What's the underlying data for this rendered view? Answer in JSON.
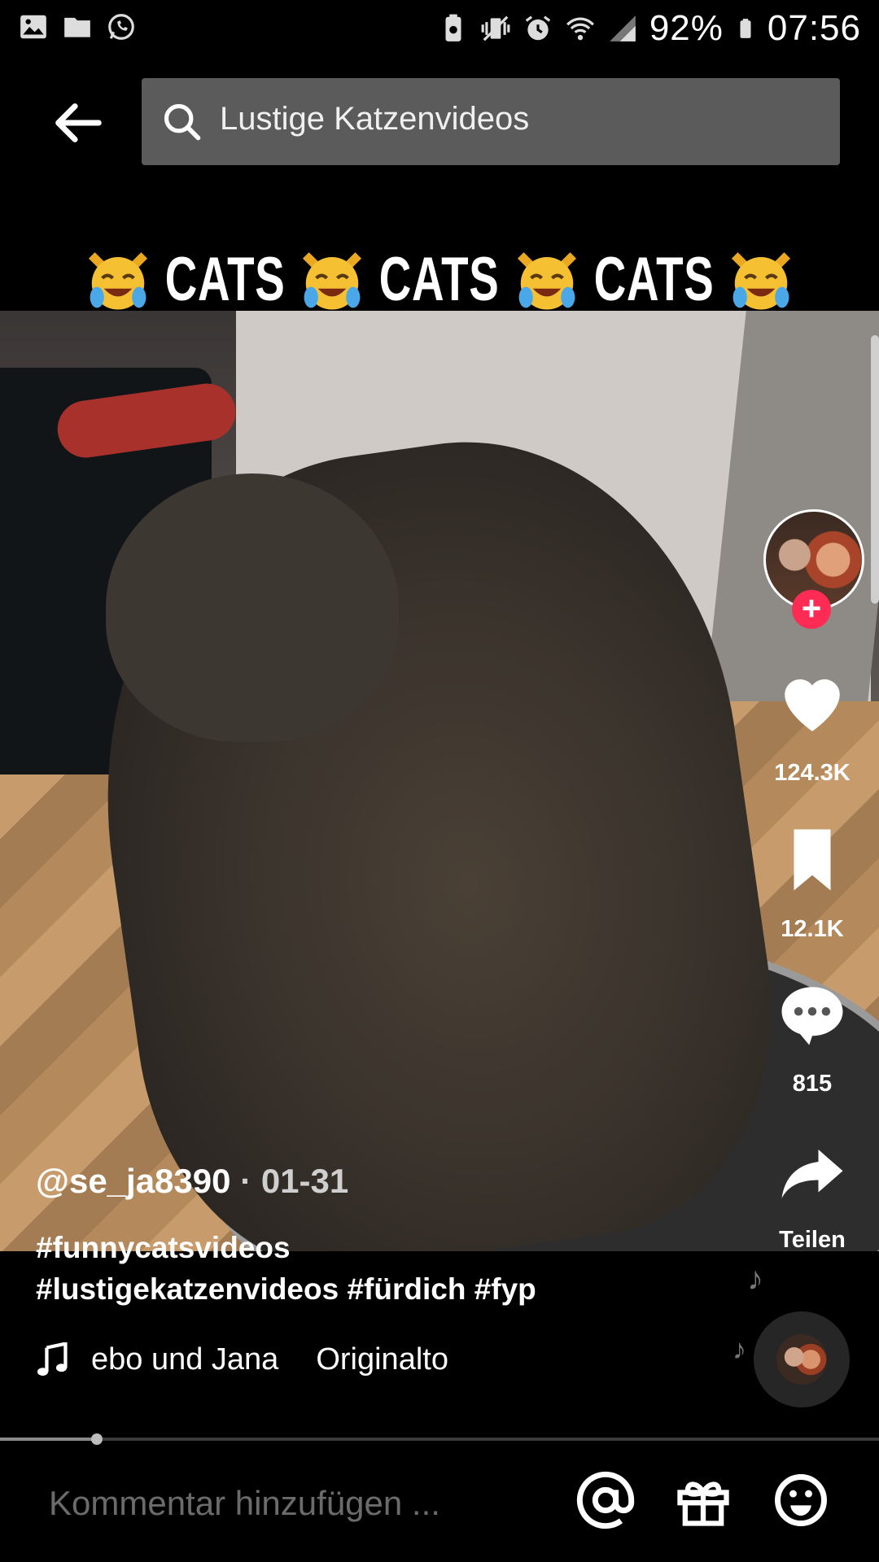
{
  "status_bar": {
    "battery_percent": "92%",
    "time": "07:56",
    "left_icons": [
      "gallery-icon",
      "folder-icon",
      "whatsapp-icon"
    ],
    "right_icons": [
      "battery-saver-icon",
      "vibrate-icon",
      "alarm-icon",
      "wifi-icon",
      "signal-icon",
      "battery-icon"
    ]
  },
  "header": {
    "search_query": "Lustige Katzenvideos"
  },
  "video": {
    "overlay_title_parts": [
      "CATS",
      "CATS",
      "CATS"
    ],
    "playback_progress": 0.11
  },
  "actions": {
    "likes": "124.3K",
    "bookmarks": "12.1K",
    "comments": "815",
    "share_label": "Teilen"
  },
  "caption": {
    "username": "@se_ja8390",
    "date": " · 01-31",
    "hashtags_line1": "#funnycatsvideos",
    "hashtags_line2": "#lustigekatzenvideos #fürdich #fyp",
    "music_parts": [
      "ebo und Jana",
      "Originalto"
    ]
  },
  "comment_bar": {
    "placeholder": "Kommentar hinzufügen ..."
  },
  "colors": {
    "follow_accent": "#fe2c55",
    "search_bg": "#5b5b5b",
    "background": "#000000"
  }
}
